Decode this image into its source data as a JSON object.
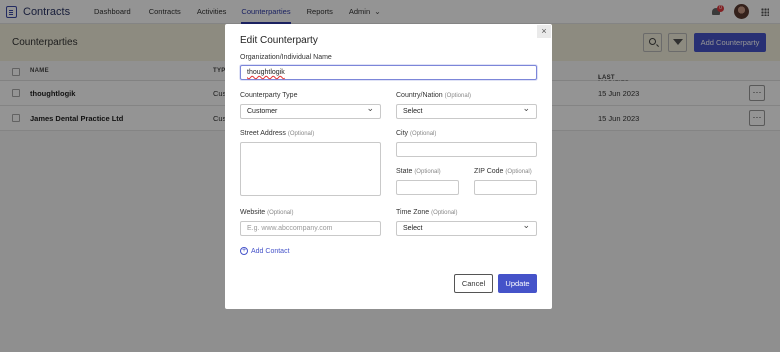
{
  "app": {
    "title": "Contracts"
  },
  "nav": {
    "items": [
      {
        "label": "Dashboard"
      },
      {
        "label": "Contracts"
      },
      {
        "label": "Activities"
      },
      {
        "label": "Counterparties"
      },
      {
        "label": "Reports"
      },
      {
        "label": "Admin"
      }
    ],
    "active": "Counterparties",
    "notification_count": "0"
  },
  "page": {
    "title": "Counterparties",
    "add_button": "Add Counterparty"
  },
  "table": {
    "headers": {
      "name": "NAME",
      "type": "TYP",
      "last_modified": "LAST MODIFIED ON"
    },
    "rows": [
      {
        "name": "thoughtlogik",
        "type": "Cus",
        "date": "15 Jun 2023"
      },
      {
        "name": "James Dental Practice Ltd",
        "type": "Cus",
        "date": "15 Jun 2023"
      }
    ],
    "more": "···"
  },
  "modal": {
    "title": "Edit Counterparty",
    "close": "×",
    "org_label": "Organization/Individual Name",
    "org_value": "thoughtlogik",
    "type_label": "Counterparty Type",
    "type_value": "Customer",
    "country_label": "Country/Nation",
    "country_value": "Select",
    "street_label": "Street Address",
    "city_label": "City",
    "state_label": "State",
    "zip_label": "ZIP Code",
    "website_label": "Website",
    "website_placeholder": "E.g. www.abccompany.com",
    "timezone_label": "Time Zone",
    "timezone_value": "Select",
    "optional": "(Optional)",
    "add_contact": "Add Contact",
    "cancel": "Cancel",
    "update": "Update"
  },
  "colors": {
    "accent": "#4553c9",
    "header_bg": "#f3f0dd",
    "badge": "#e0393e"
  }
}
